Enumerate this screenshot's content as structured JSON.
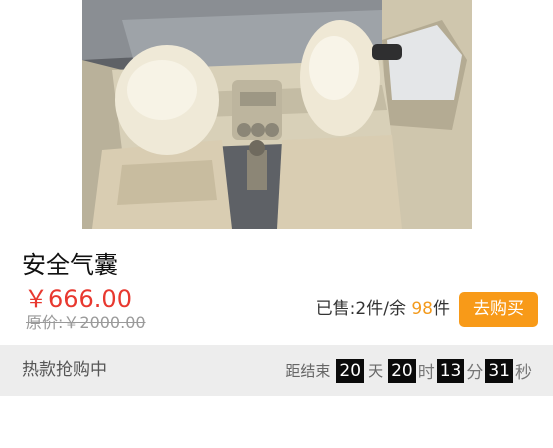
{
  "product": {
    "name": "安全气囊",
    "price": "￥666.00",
    "original_price": "原价:￥2000.00",
    "sold_prefix": "已售:",
    "sold_count": "2件",
    "stock_prefix": "/余 ",
    "stock_count": "98",
    "stock_unit": "件",
    "buy_label": "去购买"
  },
  "flash_sale": {
    "label": "热款抢购中",
    "ends_prefix": "距结束",
    "days": "20",
    "days_unit": "天",
    "hours": "20",
    "hours_unit": "时",
    "minutes": "13",
    "minutes_unit": "分",
    "seconds": "31",
    "seconds_unit": "秒"
  },
  "colors": {
    "price": "#e8382f",
    "stock_accent": "#f39a1c",
    "buy_button": "#f89a18",
    "flash_bar_bg": "#ededed",
    "countdown_box": "#0a0a0a"
  }
}
